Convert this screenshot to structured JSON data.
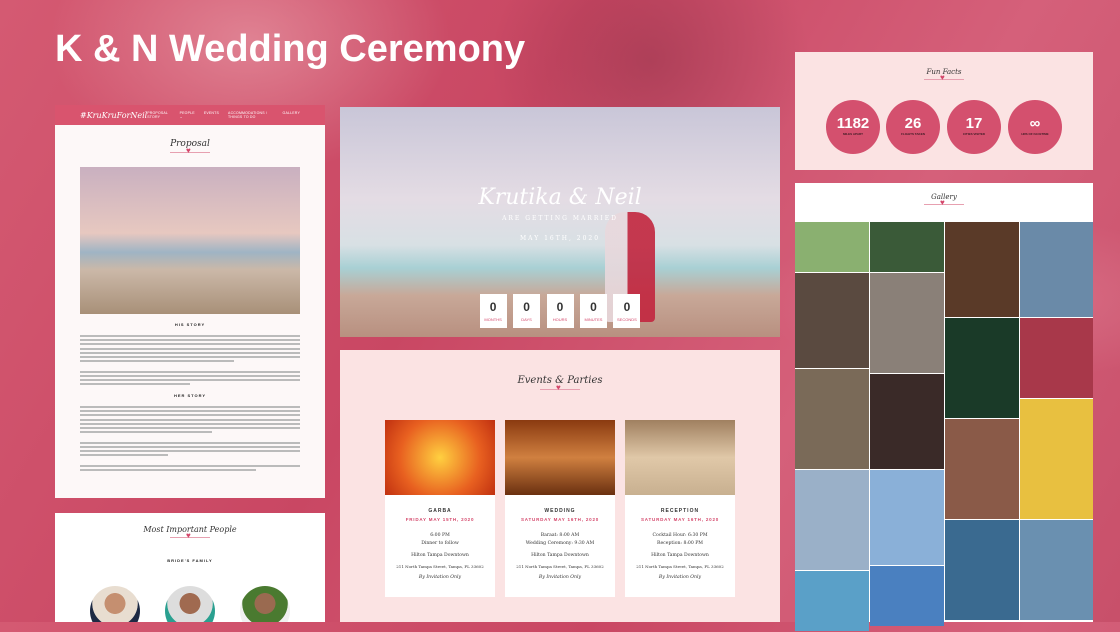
{
  "title": "K & N Wedding Ceremony",
  "proposal": {
    "logo": "#KruKruForNeil",
    "nav": [
      "PROPOSAL STORY",
      "PEOPLE ⌄",
      "EVENTS",
      "ACCOMMODATIONS / THINGS TO DO",
      "GALLERY"
    ],
    "heading": "Proposal",
    "his_story": "HIS STORY",
    "her_story": "HER STORY"
  },
  "people": {
    "heading": "Most Important People",
    "group": "BRIDE'S FAMILY"
  },
  "hero": {
    "names": "Krutika & Neil",
    "subtitle": "ARE GETTING MARRIED",
    "date": "MAY 16TH, 2020",
    "countdown": [
      {
        "value": "0",
        "label": "MONTHS"
      },
      {
        "value": "0",
        "label": "DAYS"
      },
      {
        "value": "0",
        "label": "HOURS"
      },
      {
        "value": "0",
        "label": "MINUTES"
      },
      {
        "value": "0",
        "label": "SECONDS"
      }
    ]
  },
  "events": {
    "heading": "Events & Parties",
    "cards": [
      {
        "name": "GARBA",
        "date": "FRIDAY MAY 15TH, 2020",
        "l1": "6:00 PM",
        "l2": "Dinner to follow",
        "venue": "Hilton Tampa Downtown",
        "addr": "211 North Tampa Street, Tampa, FL 33602",
        "note": "By Invitation Only"
      },
      {
        "name": "WEDDING",
        "date": "SATURDAY MAY 16TH, 2020",
        "l1": "Baraat: 8:00 AM",
        "l2": "Wedding Ceremony: 9:30 AM",
        "venue": "Hilton Tampa Downtown",
        "addr": "211 North Tampa Street, Tampa, FL 33602",
        "note": "By Invitation Only"
      },
      {
        "name": "RECEPTION",
        "date": "SATURDAY MAY 16TH, 2020",
        "l1": "Cocktail Hour: 6:30 PM",
        "l2": "Reception: 8:00 PM",
        "venue": "Hilton Tampa Downtown",
        "addr": "211 North Tampa Street, Tampa, FL 33602",
        "note": "By Invitation Only"
      }
    ]
  },
  "fun_facts": {
    "heading": "Fun Facts",
    "items": [
      {
        "value": "1182",
        "label": "MILES APART"
      },
      {
        "value": "26",
        "label": "FLIGHTS TAKEN"
      },
      {
        "value": "17",
        "label": "CITIES VISITED"
      },
      {
        "value": "∞",
        "label": "HRS OF FACETIME"
      }
    ]
  },
  "gallery": {
    "heading": "Gallery"
  },
  "colors": {
    "accent": "#d9546e",
    "pink_bg": "#fbe3e3"
  }
}
